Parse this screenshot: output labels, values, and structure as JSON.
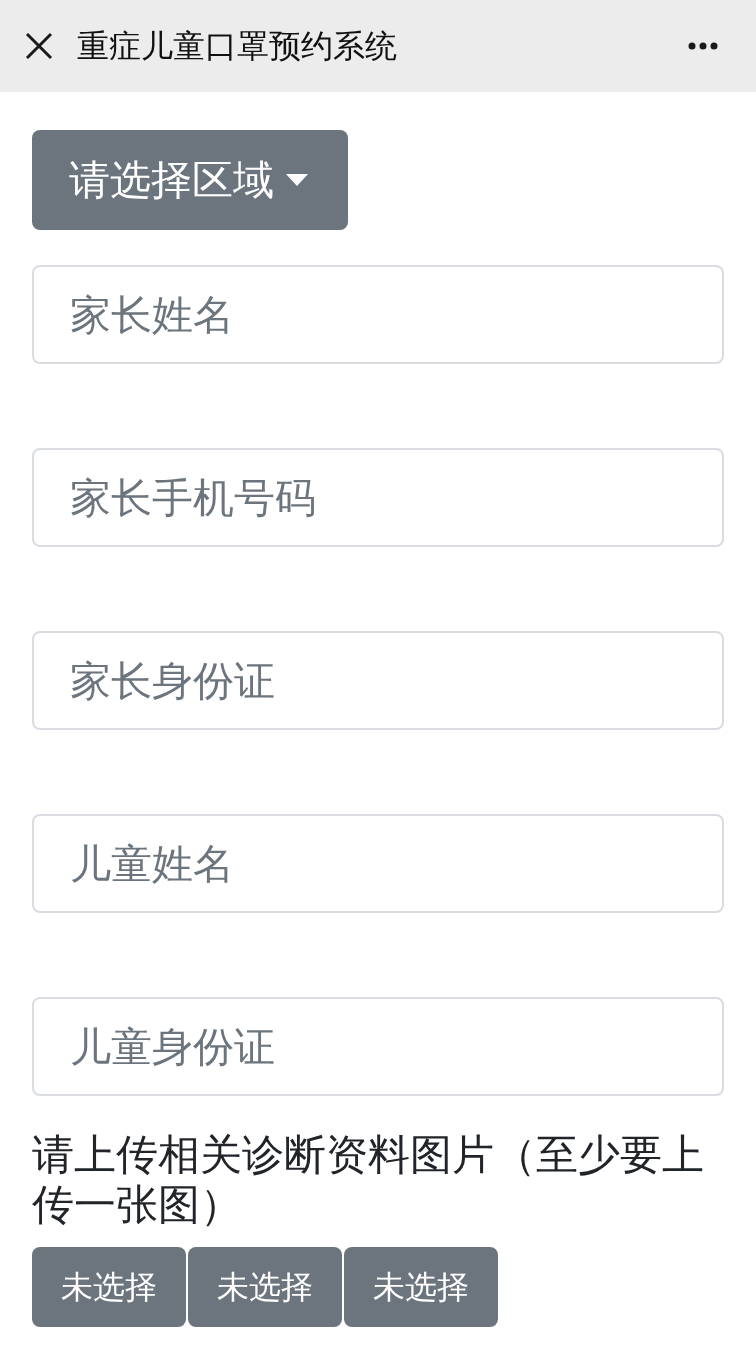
{
  "header": {
    "title": "重症儿童口罩预约系统"
  },
  "region_select": {
    "label": "请选择区域"
  },
  "fields": [
    {
      "placeholder": "家长姓名"
    },
    {
      "placeholder": "家长手机号码"
    },
    {
      "placeholder": "家长身份证"
    },
    {
      "placeholder": "儿童姓名"
    },
    {
      "placeholder": "儿童身份证"
    }
  ],
  "upload": {
    "label": "请上传相关诊断资料图片（至少要上传一张图）",
    "buttons": [
      "未选择",
      "未选择",
      "未选择"
    ]
  }
}
